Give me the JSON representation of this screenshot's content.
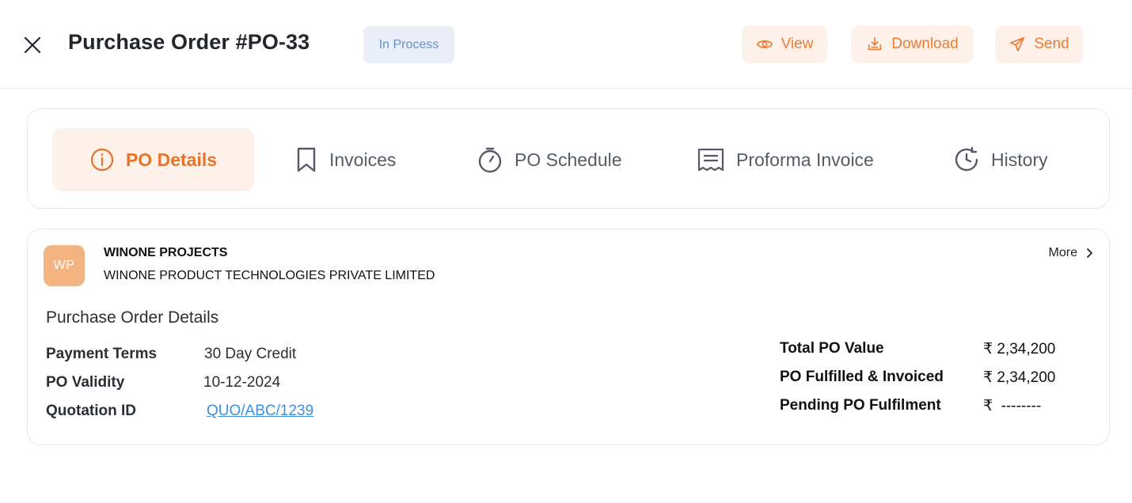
{
  "header": {
    "title": "Purchase Order #PO-33",
    "status": "In Process",
    "actions": {
      "view": "View",
      "download": "Download",
      "send": "Send"
    }
  },
  "tabs": [
    {
      "label": "PO Details",
      "icon": "info-icon",
      "active": true
    },
    {
      "label": "Invoices",
      "icon": "bookmark-icon"
    },
    {
      "label": "PO Schedule",
      "icon": "stopwatch-icon"
    },
    {
      "label": "Proforma Invoice",
      "icon": "receipt-icon"
    },
    {
      "label": "History",
      "icon": "history-icon"
    }
  ],
  "vendor": {
    "initials": "WP",
    "name": "WINONE PROJECTS",
    "company": "WINONE PRODUCT TECHNOLOGIES PRIVATE LIMITED",
    "more": "More"
  },
  "details": {
    "section_title": "Purchase Order Details",
    "fields": [
      {
        "label": "Payment Terms",
        "value": "30 Day Credit"
      },
      {
        "label": "PO Validity",
        "value": "10-12-2024"
      },
      {
        "label": "Quotation ID",
        "value": "QUO/ABC/1239"
      }
    ],
    "summary": [
      {
        "label": "Total PO Value",
        "value": "₹ 2,34,200"
      },
      {
        "label": "PO Fulfilled & Invoiced",
        "value": "₹ 2,34,200"
      },
      {
        "label": "Pending PO Fulfilment",
        "value": "₹  --------"
      }
    ]
  },
  "colors": {
    "accent": "#ee7b32",
    "accent_bg": "#fdf1ea",
    "status_bg": "#e9eef9",
    "status_text": "#6a8fc7",
    "link": "#3d8fe0",
    "avatar_bg": "#f4b481"
  }
}
